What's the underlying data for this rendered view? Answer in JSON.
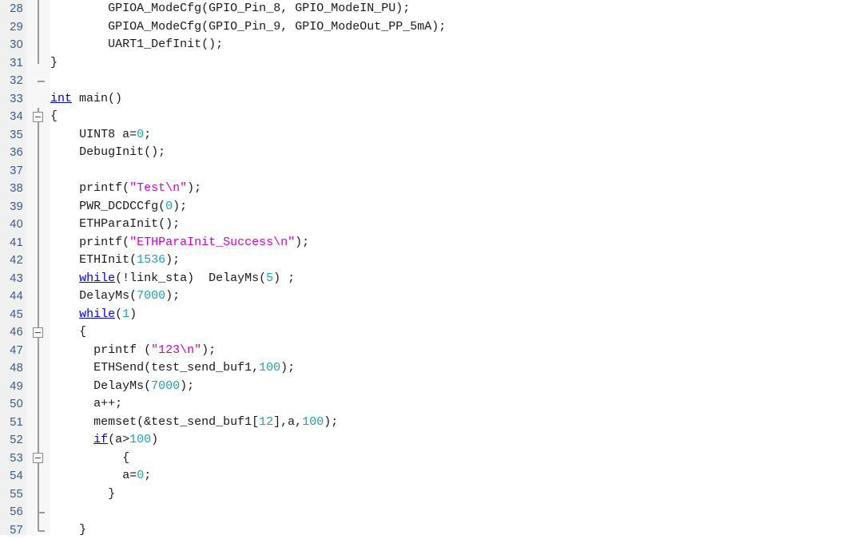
{
  "editor": {
    "kind": "c-source-code-editor",
    "gutter_label": "line-numbers",
    "colors": {
      "background": "#ffffff",
      "gutter_background": "#f0f0f0",
      "fold_background": "#f7f7f7",
      "line_number": "#3b5a86",
      "text": "#1a1a1a",
      "keyword": "#0000cd",
      "string": "#cc00cc",
      "number": "#20a0b0",
      "fold_rail": "#9a9a9a"
    },
    "first_visible_line": 28,
    "last_visible_line": 57
  },
  "lines": [
    {
      "n": "28",
      "indent": 4,
      "tokens": [
        {
          "t": "GPIOA_ModeCfg(GPIO_Pin_8, GPIO_ModeIN_PU);",
          "c": "plain"
        }
      ]
    },
    {
      "n": "29",
      "indent": 4,
      "tokens": [
        {
          "t": "GPIOA_ModeCfg(GPIO_Pin_9, GPIO_ModeOut_PP_5mA);",
          "c": "plain"
        }
      ]
    },
    {
      "n": "30",
      "indent": 4,
      "tokens": [
        {
          "t": "UART1_DefInit();",
          "c": "plain"
        }
      ]
    },
    {
      "n": "31",
      "indent": 0,
      "tokens": [
        {
          "t": "}",
          "c": "plain"
        }
      ]
    },
    {
      "n": "32",
      "indent": 0,
      "tokens": []
    },
    {
      "n": "33",
      "indent": 0,
      "tokens": [
        {
          "t": "int",
          "c": "kw"
        },
        {
          "t": " main()",
          "c": "plain"
        }
      ]
    },
    {
      "n": "34",
      "indent": 0,
      "tokens": [
        {
          "t": "{",
          "c": "plain"
        }
      ]
    },
    {
      "n": "35",
      "indent": 2,
      "tokens": [
        {
          "t": "UINT8 a=",
          "c": "plain"
        },
        {
          "t": "0",
          "c": "num"
        },
        {
          "t": ";",
          "c": "plain"
        }
      ]
    },
    {
      "n": "36",
      "indent": 2,
      "tokens": [
        {
          "t": "DebugInit();",
          "c": "plain"
        }
      ]
    },
    {
      "n": "37",
      "indent": 0,
      "tokens": []
    },
    {
      "n": "38",
      "indent": 2,
      "tokens": [
        {
          "t": "printf(",
          "c": "plain"
        },
        {
          "t": "\"Test\\n\"",
          "c": "str"
        },
        {
          "t": ");",
          "c": "plain"
        }
      ]
    },
    {
      "n": "39",
      "indent": 2,
      "tokens": [
        {
          "t": "PWR_DCDCCfg(",
          "c": "plain"
        },
        {
          "t": "0",
          "c": "num"
        },
        {
          "t": ");",
          "c": "plain"
        }
      ]
    },
    {
      "n": "40",
      "indent": 2,
      "tokens": [
        {
          "t": "ETHParaInit();",
          "c": "plain"
        }
      ]
    },
    {
      "n": "41",
      "indent": 2,
      "tokens": [
        {
          "t": "printf(",
          "c": "plain"
        },
        {
          "t": "\"ETHParaInit_Success\\n\"",
          "c": "str"
        },
        {
          "t": ");",
          "c": "plain"
        }
      ]
    },
    {
      "n": "42",
      "indent": 2,
      "tokens": [
        {
          "t": "ETHInit(",
          "c": "plain"
        },
        {
          "t": "1536",
          "c": "num"
        },
        {
          "t": ");",
          "c": "plain"
        }
      ]
    },
    {
      "n": "43",
      "indent": 2,
      "tokens": [
        {
          "t": "while",
          "c": "kw"
        },
        {
          "t": "(!link_sta)  DelayMs(",
          "c": "plain"
        },
        {
          "t": "5",
          "c": "num"
        },
        {
          "t": ") ;",
          "c": "plain"
        }
      ]
    },
    {
      "n": "44",
      "indent": 2,
      "tokens": [
        {
          "t": "DelayMs(",
          "c": "plain"
        },
        {
          "t": "7000",
          "c": "num"
        },
        {
          "t": ");",
          "c": "plain"
        }
      ]
    },
    {
      "n": "45",
      "indent": 2,
      "tokens": [
        {
          "t": "while",
          "c": "kw"
        },
        {
          "t": "(",
          "c": "plain"
        },
        {
          "t": "1",
          "c": "num"
        },
        {
          "t": ")",
          "c": "plain"
        }
      ]
    },
    {
      "n": "46",
      "indent": 2,
      "tokens": [
        {
          "t": "{",
          "c": "plain"
        }
      ]
    },
    {
      "n": "47",
      "indent": 3,
      "tokens": [
        {
          "t": "printf (",
          "c": "plain"
        },
        {
          "t": "\"123\\n\"",
          "c": "str"
        },
        {
          "t": ");",
          "c": "plain"
        }
      ]
    },
    {
      "n": "48",
      "indent": 3,
      "tokens": [
        {
          "t": "ETHSend(test_send_buf1,",
          "c": "plain"
        },
        {
          "t": "100",
          "c": "num"
        },
        {
          "t": ");",
          "c": "plain"
        }
      ]
    },
    {
      "n": "49",
      "indent": 3,
      "tokens": [
        {
          "t": "DelayMs(",
          "c": "plain"
        },
        {
          "t": "7000",
          "c": "num"
        },
        {
          "t": ");",
          "c": "plain"
        }
      ]
    },
    {
      "n": "50",
      "indent": 3,
      "tokens": [
        {
          "t": "a++;",
          "c": "plain"
        }
      ]
    },
    {
      "n": "51",
      "indent": 3,
      "tokens": [
        {
          "t": "memset(&test_send_buf1[",
          "c": "plain"
        },
        {
          "t": "12",
          "c": "num"
        },
        {
          "t": "],a,",
          "c": "plain"
        },
        {
          "t": "100",
          "c": "num"
        },
        {
          "t": ");",
          "c": "plain"
        }
      ]
    },
    {
      "n": "52",
      "indent": 3,
      "tokens": [
        {
          "t": "if",
          "c": "kw"
        },
        {
          "t": "(a>",
          "c": "plain"
        },
        {
          "t": "100",
          "c": "num"
        },
        {
          "t": ")",
          "c": "plain"
        }
      ]
    },
    {
      "n": "53",
      "indent": 5,
      "tokens": [
        {
          "t": "{",
          "c": "plain"
        }
      ]
    },
    {
      "n": "54",
      "indent": 5,
      "tokens": [
        {
          "t": "a=",
          "c": "plain"
        },
        {
          "t": "0",
          "c": "num"
        },
        {
          "t": ";",
          "c": "plain"
        }
      ]
    },
    {
      "n": "55",
      "indent": 4,
      "tokens": [
        {
          "t": "}",
          "c": "plain"
        }
      ]
    },
    {
      "n": "56",
      "indent": 0,
      "tokens": []
    },
    {
      "n": "57",
      "indent": 2,
      "tokens": [
        {
          "t": "}",
          "c": "plain"
        }
      ]
    }
  ],
  "fold_markers": {
    "rails": [
      {
        "from_line": "28",
        "to_line": "31",
        "label": "fold-rail-function-debug-init"
      },
      {
        "from_line": "34",
        "to_line": "57",
        "label": "fold-rail-function-main"
      }
    ],
    "end_elbows": [
      {
        "line": "32",
        "label": "fold-end-debug-init"
      }
    ],
    "boxes": [
      {
        "line": "34",
        "state": "expanded",
        "label": "fold-box-main"
      },
      {
        "line": "46",
        "state": "expanded",
        "label": "fold-box-while-loop"
      },
      {
        "line": "53",
        "state": "expanded",
        "label": "fold-box-if-block"
      }
    ],
    "ticks": [
      {
        "line": "56",
        "label": "fold-tick-56"
      },
      {
        "line": "57",
        "label": "fold-tick-57"
      }
    ]
  }
}
